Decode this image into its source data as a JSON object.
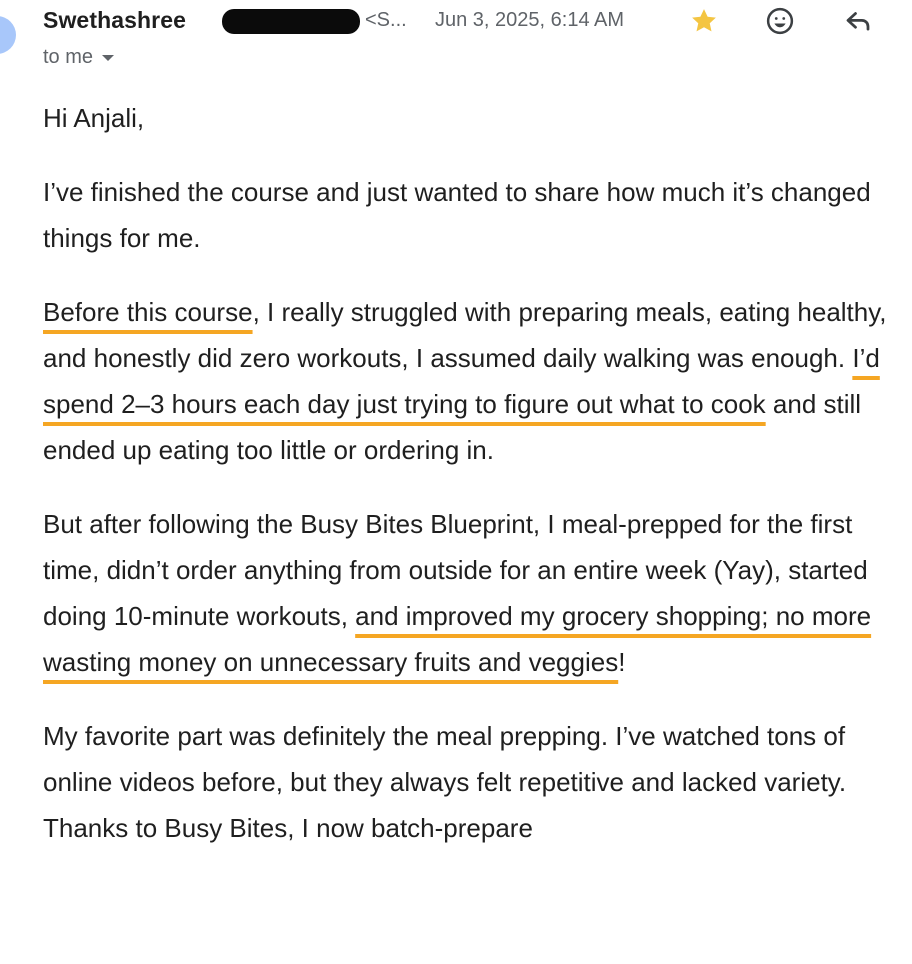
{
  "email": {
    "sender_name": "Swethashree",
    "sender_email": "<S...",
    "timestamp": "Jun 3, 2025, 6:14 AM",
    "recipient": "to me",
    "starred": true,
    "greeting": "Hi Anjali,",
    "p1": "I’ve finished the course and just wanted to share how much it’s changed things for me.",
    "p2": {
      "h1": "Before this course",
      "t1": ", I really struggled with preparing meals, eating healthy, and honestly did zero workouts, I assumed daily walking was enough. ",
      "h2": "I’d spend 2–3 hours each day just trying to figure out what to cook",
      "t2": " and still ended up eating too little or ordering in."
    },
    "p3": {
      "t1": "But after following the Busy Bites Blueprint, I meal-prepped for the first time, didn’t order anything from outside for an entire week (Yay), started doing 10-minute workouts, ",
      "h1": "and improved my grocery shopping; no more wasting money on unnecessary fruits and veggies",
      "t2": "!"
    },
    "p4": "My favorite part was definitely the meal prepping. I’ve watched tons of online videos before, but they always felt repetitive and lacked variety. Thanks to Busy Bites, I now batch-prepare"
  },
  "icons": {
    "star": "star-icon",
    "emoji": "emoji-reaction-icon",
    "reply": "reply-icon",
    "more": "more-options-icon",
    "chevron": "chevron-down-icon"
  },
  "colors": {
    "highlight": "#f5a623",
    "star": "#f4c542",
    "redaction": "#0b0b0b"
  }
}
